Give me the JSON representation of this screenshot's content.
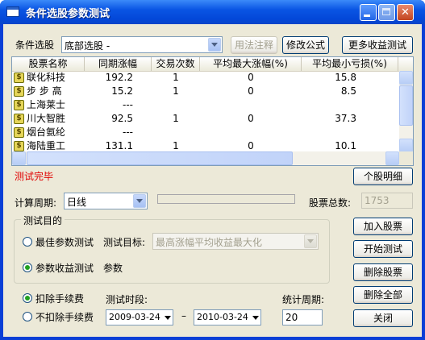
{
  "window": {
    "title": "条件选股参数测试",
    "close_glyph": "✕"
  },
  "condition": {
    "label": "条件选股",
    "value": "底部选股  -",
    "help_btn": "用法注释",
    "edit_btn": "修改公式",
    "more_btn": "更多收益测试"
  },
  "table": {
    "columns": [
      "股票名称",
      "同期涨幅",
      "交易次数",
      "平均最大涨幅(%)",
      "平均最小亏损(%)"
    ],
    "rows": [
      {
        "name": "联化科技",
        "gain": "192.2",
        "trades": "1",
        "avg_max": "0",
        "avg_min": "15.8"
      },
      {
        "name": "步 步 高",
        "gain": "15.2",
        "trades": "1",
        "avg_max": "0",
        "avg_min": "8.5"
      },
      {
        "name": "上海莱士",
        "gain": "---",
        "trades": "",
        "avg_max": "",
        "avg_min": ""
      },
      {
        "name": "川大智胜",
        "gain": "92.5",
        "trades": "1",
        "avg_max": "0",
        "avg_min": "37.3"
      },
      {
        "name": "烟台氨纶",
        "gain": "---",
        "trades": "",
        "avg_max": "",
        "avg_min": ""
      },
      {
        "name": "海陆重工",
        "gain": "131.1",
        "trades": "1",
        "avg_max": "0",
        "avg_min": "10.1"
      }
    ],
    "row_icon": "$"
  },
  "status": {
    "text": "测试完毕",
    "color": "#e00000"
  },
  "detail_btn": "个股明细",
  "period": {
    "label": "计算周期:",
    "value": "日线"
  },
  "progress_value": 0,
  "stock_total": {
    "label": "股票总数:",
    "value": "1753"
  },
  "purpose": {
    "title": "测试目的",
    "best": {
      "label": "最佳参数测试",
      "selected": false
    },
    "target_label": "测试目标:",
    "target_value": "最高涨幅平均收益最大化",
    "gain": {
      "label": "参数收益测试",
      "selected": true
    },
    "param_label": "参数"
  },
  "fee": {
    "deduct": "扣除手续费",
    "deduct_selected": true,
    "no_deduct": "不扣除手续费",
    "no_deduct_selected": false
  },
  "test_period": {
    "label": "测试时段:",
    "start": "2009-03-24",
    "end": "2010-03-24",
    "sep": "–"
  },
  "stat_period": {
    "label": "统计周期:",
    "value": "20"
  },
  "buttons": {
    "add": "加入股票",
    "start": "开始测试",
    "delete": "删除股票",
    "delete_all": "删除全部",
    "close": "关闭"
  }
}
